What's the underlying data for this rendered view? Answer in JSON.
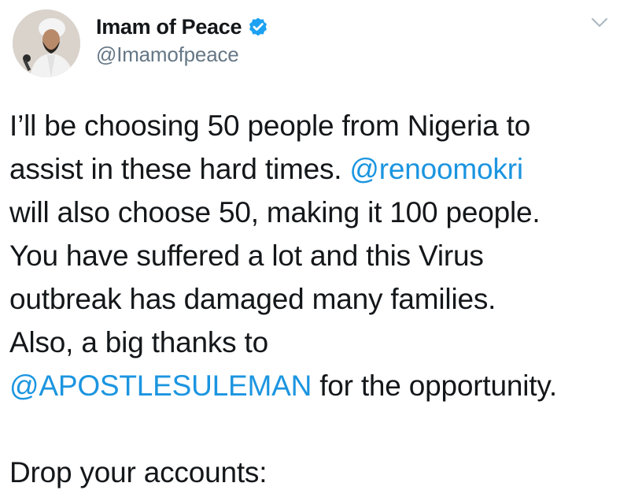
{
  "user": {
    "display_name": "Imam of Peace",
    "handle": "@Imamofpeace",
    "verified": true,
    "verified_color": "#1da1f2",
    "avatar_icon": "user-avatar"
  },
  "tweet": {
    "line1": "I’ll be choosing 50 people from Nigeria to",
    "line2_text": "assist in these hard times. ",
    "line2_mention": "@renoomokri",
    "line3": "will also choose 50, making it 100 people.",
    "line4": "You have suffered a lot and this Virus",
    "line5": "outbreak has damaged many families.",
    "line6": "Also, a big thanks to",
    "line7_mention": "@APOSTLESULEMAN",
    "line7_text": " for the opportunity.",
    "line8": "Drop your accounts:"
  },
  "colors": {
    "text": "#14171a",
    "secondary": "#657786",
    "link": "#1b95e0"
  },
  "icons": {
    "more": "chevron-down-icon",
    "verified": "verified-badge-icon"
  }
}
